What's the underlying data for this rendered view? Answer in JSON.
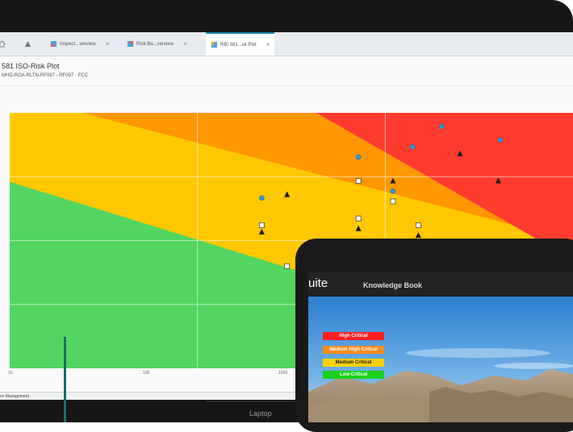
{
  "laptop_label": "Laptop",
  "tabs": [
    {
      "label": "",
      "icon": "home-icon"
    },
    {
      "label": "",
      "icon": "warning-triangle-icon"
    },
    {
      "label": "Inspect...verview",
      "icon": "grid-icon"
    },
    {
      "label": "Risk Ba...verview",
      "icon": "grid-icon"
    },
    {
      "label": "RBI 581...sk Plot",
      "icon": "grid-icon"
    }
  ],
  "page": {
    "title": "581 ISO-Risk Plot",
    "subtitle": "MHD-ROA-RLTN-RF097 - RF097 - FCC"
  },
  "status_text": "ce Management",
  "tablet": {
    "suite_text": "uite",
    "knowledge_book": "Knowledge Book",
    "legend": [
      {
        "label": "High Critical",
        "color": "#ff1e1e"
      },
      {
        "label": "Medium High Critical",
        "color": "#ff8c1e"
      },
      {
        "label": "Medium Critical",
        "color": "#ffd200"
      },
      {
        "label": "Low Critical",
        "color": "#19d219"
      }
    ]
  },
  "chart_data": {
    "type": "scatter",
    "xscale": "log",
    "xlim": [
      10,
      10000
    ],
    "xticks": [
      "10",
      "100",
      "1000"
    ],
    "region_colors": [
      "#52d560",
      "#ffc800",
      "#ff9700",
      "#ff3b30"
    ],
    "series": [
      {
        "marker": "circle",
        "color": "#2b9ad3",
        "points": [
          [
            220,
            50
          ],
          [
            720,
            38
          ],
          [
            1100,
            48
          ],
          [
            1400,
            35
          ],
          [
            2000,
            29
          ],
          [
            4100,
            33
          ]
        ]
      },
      {
        "marker": "square",
        "color": "#ffffff",
        "points": [
          [
            220,
            58
          ],
          [
            300,
            70
          ],
          [
            720,
            45
          ],
          [
            720,
            56
          ],
          [
            1100,
            51
          ],
          [
            1500,
            58
          ]
        ]
      },
      {
        "marker": "triangle",
        "color": "#1a1a1a",
        "points": [
          [
            220,
            60
          ],
          [
            300,
            49
          ],
          [
            720,
            59
          ],
          [
            1100,
            45
          ],
          [
            1500,
            61
          ],
          [
            2500,
            37
          ],
          [
            4000,
            45
          ]
        ]
      }
    ]
  }
}
